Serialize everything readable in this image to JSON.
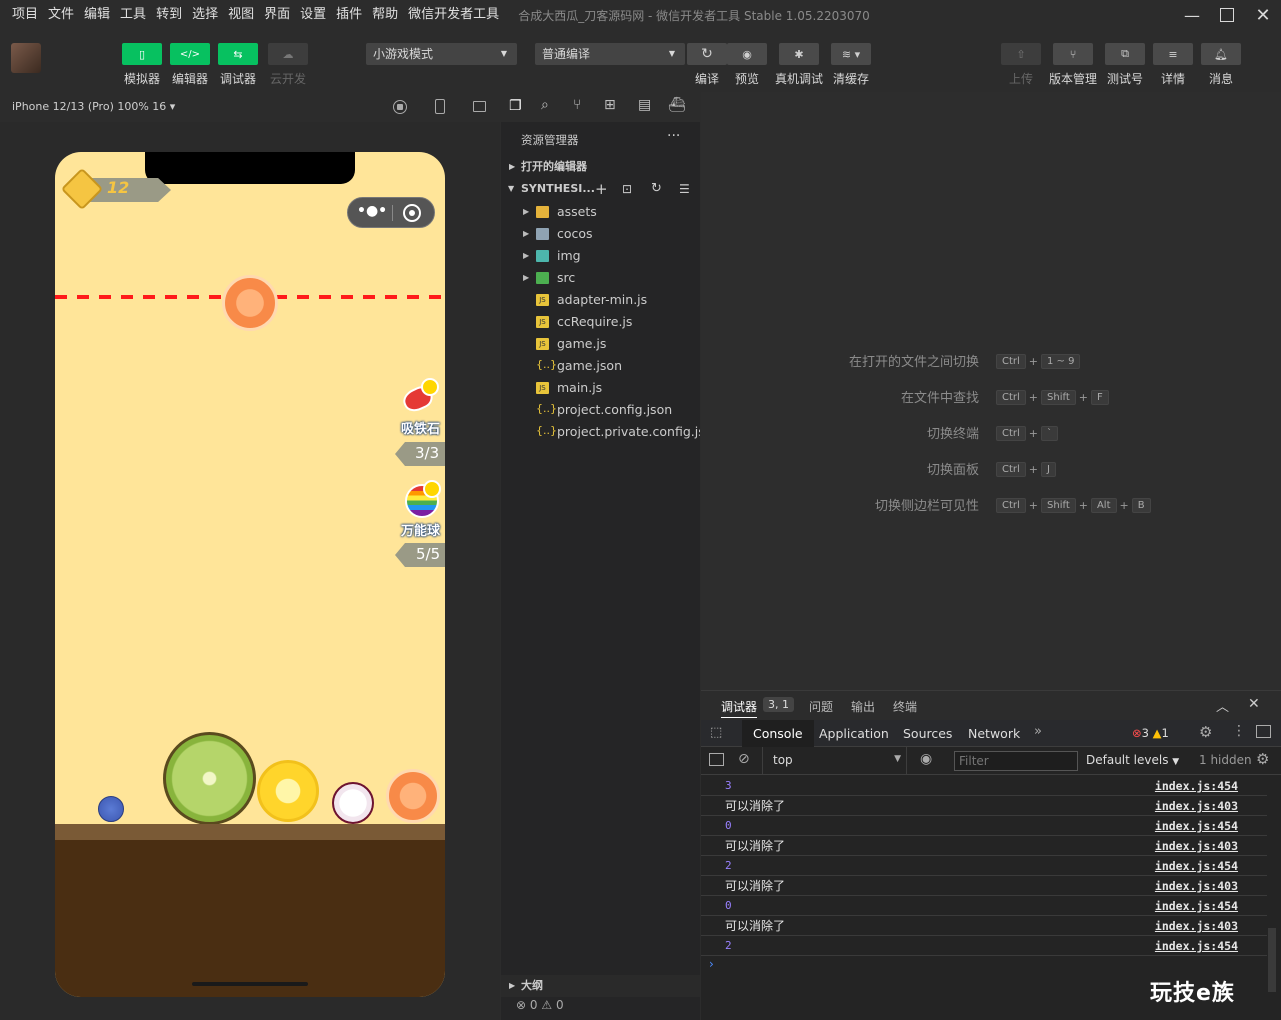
{
  "menu": {
    "items": [
      "项目",
      "文件",
      "编辑",
      "工具",
      "转到",
      "选择",
      "视图",
      "界面",
      "设置",
      "插件",
      "帮助",
      "微信开发者工具"
    ],
    "title": "合成大西瓜_刀客源码网 - 微信开发者工具 Stable 1.05.2203070"
  },
  "toolbar": {
    "simulator": "模拟器",
    "editor": "编辑器",
    "debugger": "调试器",
    "cloud": "云开发",
    "mode_select": "小游戏模式",
    "compile_select": "普通编译",
    "compile": "编译",
    "preview": "预览",
    "real_debug": "真机调试",
    "clear_cache": "清缓存",
    "upload": "上传",
    "version": "版本管理",
    "test_id": "测试号",
    "details": "详情",
    "messages": "消息"
  },
  "simulator": {
    "device": "iPhone 12/13 (Pro) 100% 16 ▾",
    "game": {
      "score": "12",
      "magnet_label": "吸铁石",
      "magnet_count": "3/3",
      "omni_label": "万能球",
      "omni_count": "5/5"
    }
  },
  "explorer": {
    "title": "资源管理器",
    "open_editors": "打开的编辑器",
    "project": "SYNTHESI...",
    "items": [
      {
        "name": "assets",
        "type": "folder",
        "color": "#e5b33b"
      },
      {
        "name": "cocos",
        "type": "folder",
        "color": "#8fa3b3"
      },
      {
        "name": "img",
        "type": "folder",
        "color": "#4db6ac"
      },
      {
        "name": "src",
        "type": "folder",
        "color": "#4caf50"
      },
      {
        "name": "adapter-min.js",
        "type": "js",
        "color": "#e8c43a"
      },
      {
        "name": "ccRequire.js",
        "type": "js",
        "color": "#e8c43a"
      },
      {
        "name": "game.js",
        "type": "js",
        "color": "#e8c43a"
      },
      {
        "name": "game.json",
        "type": "json",
        "color": "#e8c43a"
      },
      {
        "name": "main.js",
        "type": "js",
        "color": "#e8c43a"
      },
      {
        "name": "project.config.json",
        "type": "json",
        "color": "#e8c43a"
      },
      {
        "name": "project.private.config.js...",
        "type": "json",
        "color": "#e8c43a"
      }
    ],
    "outline": "大纲",
    "errors": "0",
    "warnings": "0"
  },
  "editor": {
    "shortcuts": [
      {
        "label": "在打开的文件之间切换",
        "keys": [
          "Ctrl",
          "+",
          "1 ~ 9"
        ]
      },
      {
        "label": "在文件中查找",
        "keys": [
          "Ctrl",
          "+",
          "Shift",
          "+",
          "F"
        ]
      },
      {
        "label": "切换终端",
        "keys": [
          "Ctrl",
          "+",
          "`"
        ]
      },
      {
        "label": "切换面板",
        "keys": [
          "Ctrl",
          "+",
          "J"
        ]
      },
      {
        "label": "切换侧边栏可见性",
        "keys": [
          "Ctrl",
          "+",
          "Shift",
          "+",
          "Alt",
          "+",
          "B"
        ]
      }
    ]
  },
  "devtools": {
    "tabs": {
      "debugger": "调试器",
      "badge": "3, 1",
      "problems": "问题",
      "output": "输出",
      "terminal": "终端"
    },
    "panels": {
      "console": "Console",
      "application": "Application",
      "sources": "Sources",
      "network": "Network"
    },
    "error_count": "3",
    "warning_count": "1",
    "context": "top",
    "filter_placeholder": "Filter",
    "levels": "Default levels",
    "hidden": "1 hidden",
    "logs": [
      {
        "msg": "3",
        "num": true,
        "src": "index.js:454"
      },
      {
        "msg": "可以消除了",
        "num": false,
        "src": "index.js:403"
      },
      {
        "msg": "0",
        "num": true,
        "src": "index.js:454"
      },
      {
        "msg": "可以消除了",
        "num": false,
        "src": "index.js:403"
      },
      {
        "msg": "2",
        "num": true,
        "src": "index.js:454"
      },
      {
        "msg": "可以消除了",
        "num": false,
        "src": "index.js:403"
      },
      {
        "msg": "0",
        "num": true,
        "src": "index.js:454"
      },
      {
        "msg": "可以消除了",
        "num": false,
        "src": "index.js:403"
      },
      {
        "msg": "2",
        "num": true,
        "src": "index.js:454"
      }
    ]
  },
  "watermark": "玩技e族"
}
